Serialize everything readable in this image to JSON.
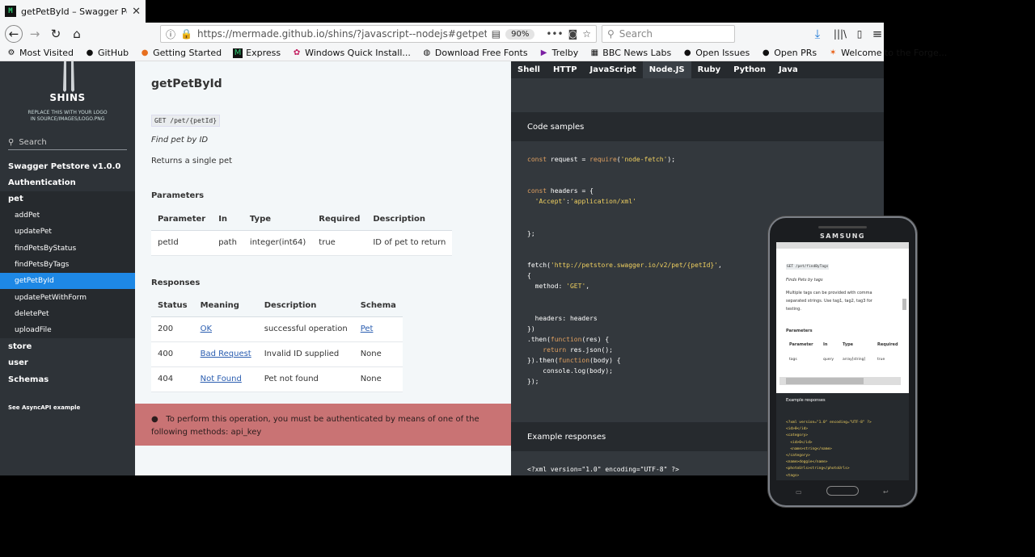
{
  "browser": {
    "tab_title": "getPetById – Swagger Petstore",
    "url": "https://mermade.github.io/shins/?javascript--nodejs#getpetbyid",
    "zoom": "90%",
    "search_placeholder": "Search",
    "bookmarks": [
      "Most Visited",
      "GitHub",
      "Getting Started",
      "Express",
      "Windows Quick Install...",
      "Download Free Fonts",
      "Trelby",
      "BBC News Labs",
      "Open Issues",
      "Open PRs",
      "Welcome to the Forge..."
    ]
  },
  "sidebar": {
    "logo_text": "SHINS",
    "logo_sub_1": "REPLACE THIS WITH YOUR LOGO",
    "logo_sub_2": "IN SOURCE/IMAGES/LOGO.PNG",
    "search_label": "Search",
    "items": [
      "Swagger Petstore v1.0.0",
      "Authentication",
      "pet"
    ],
    "pet_ops": [
      "addPet",
      "updatePet",
      "findPetsByStatus",
      "findPetsByTags",
      "getPetById",
      "updatePetWithForm",
      "deletePet",
      "uploadFile"
    ],
    "bottom_items": [
      "store",
      "user",
      "Schemas"
    ],
    "footer": "See AsyncAPI example"
  },
  "content": {
    "title": "getPetById",
    "endpoint": "GET /pet/{petId}",
    "summary": "Find pet by ID",
    "description": "Returns a single pet",
    "parameters_heading": "Parameters",
    "param_headers": [
      "Parameter",
      "In",
      "Type",
      "Required",
      "Description"
    ],
    "param_row": [
      "petId",
      "path",
      "integer(int64)",
      "true",
      "ID of pet to return"
    ],
    "responses_heading": "Responses",
    "resp_headers": [
      "Status",
      "Meaning",
      "Description",
      "Schema"
    ],
    "resp_rows": [
      [
        "200",
        "OK",
        "successful operation",
        "Pet"
      ],
      [
        "400",
        "Bad Request",
        "Invalid ID supplied",
        "None"
      ],
      [
        "404",
        "Not Found",
        "Pet not found",
        "None"
      ]
    ],
    "auth_note": "To perform this operation, you must be authenticated by means of one of the following methods: api_key"
  },
  "code_panel": {
    "languages": [
      "Shell",
      "HTTP",
      "JavaScript",
      "Node.JS",
      "Ruby",
      "Python",
      "Java"
    ],
    "active_language": "Node.JS",
    "code_samples_heading": "Code samples",
    "example_responses_heading": "Example responses",
    "xml_line": "<?xml version=\"1.0\" encoding=\"UTF-8\" ?>"
  },
  "phone": {
    "brand": "SAMSUNG",
    "endpoint": "GET /pet/findByTags",
    "summary": "Finds Pets by tags",
    "desc_1": "Multiple tags can be provided with comma",
    "desc_2": "separated strings. Use tag1, tag2, tag3 for",
    "desc_3": "testing.",
    "parameters_heading": "Parameters",
    "param_headers": [
      "Parameter",
      "In",
      "Type",
      "Required"
    ],
    "param_row": [
      "tags",
      "query",
      "array[string]",
      "true"
    ],
    "example_heading": "Example responses"
  }
}
